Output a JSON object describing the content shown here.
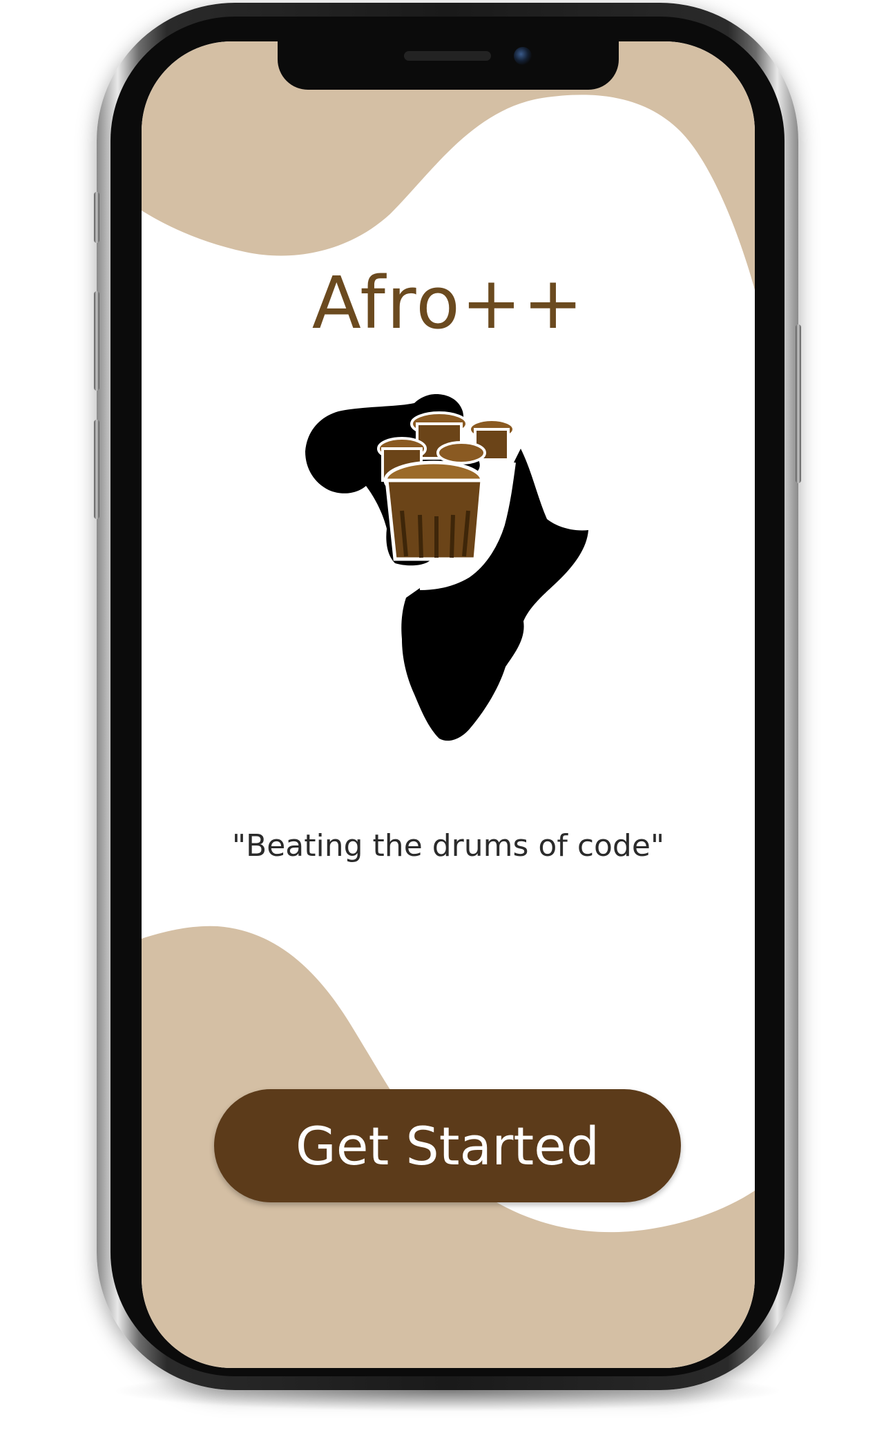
{
  "app": {
    "title": "Afro++",
    "tagline": "\"Beating the drums of code\"",
    "logo_icon": "africa-drummer-logo-icon"
  },
  "actions": {
    "get_started_label": "Get Started"
  },
  "colors": {
    "background_wave": "#d4bfa4",
    "title_brown": "#6b4a1f",
    "button_brown": "#5c3b1a",
    "button_text": "#ffffff",
    "drum_gold": "#9b6a2a",
    "silhouette": "#000000"
  },
  "device": {
    "frame_icon": "phone-frame-icon"
  }
}
